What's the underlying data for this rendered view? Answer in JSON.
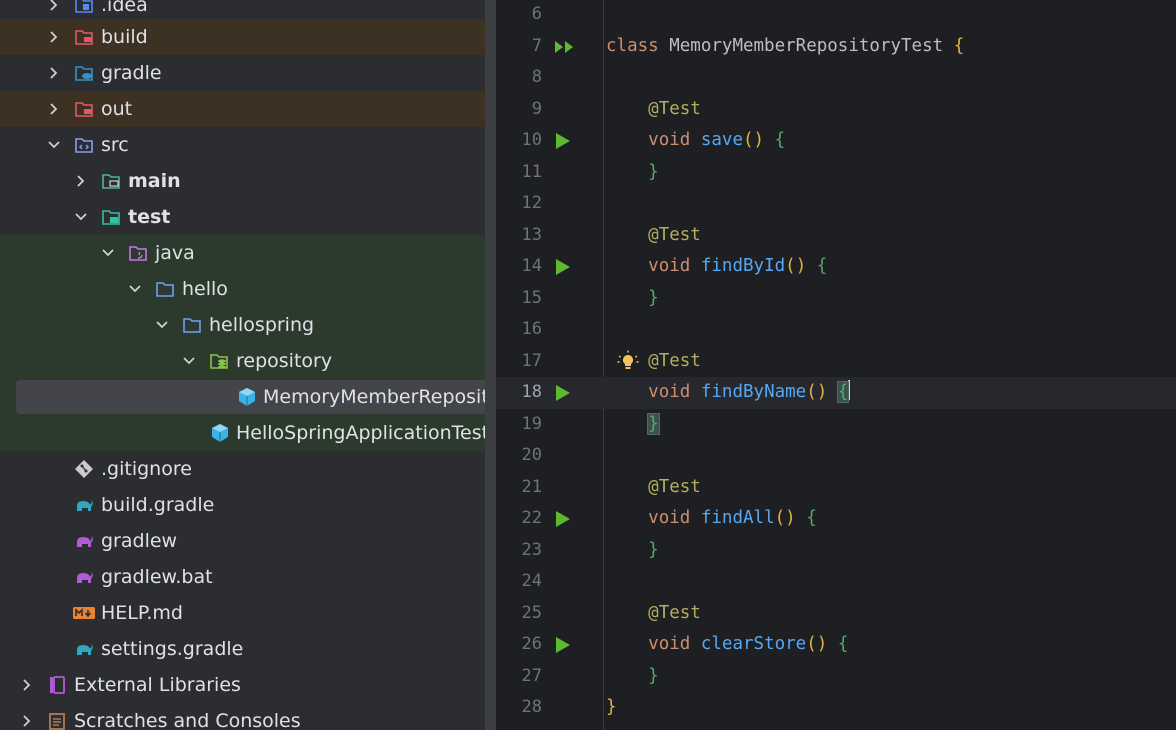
{
  "project_tree": {
    "items": [
      {
        "label": ".idea",
        "icon": "idea-folder-icon",
        "expanded": false
      },
      {
        "label": "build",
        "icon": "excluded-folder-icon",
        "expanded": false
      },
      {
        "label": "gradle",
        "icon": "gradle-folder-icon",
        "expanded": false
      },
      {
        "label": "out",
        "icon": "excluded-folder-icon",
        "expanded": false
      },
      {
        "label": "src",
        "icon": "source-folder-icon",
        "expanded": true
      },
      {
        "label": "main",
        "icon": "module-folder-icon",
        "expanded": false
      },
      {
        "label": "test",
        "icon": "test-module-folder-icon",
        "expanded": true
      },
      {
        "label": "java",
        "icon": "test-java-folder-icon",
        "expanded": true
      },
      {
        "label": "hello",
        "icon": "package-folder-icon",
        "expanded": true
      },
      {
        "label": "hellospring",
        "icon": "package-folder-icon",
        "expanded": true
      },
      {
        "label": "repository",
        "icon": "test-package-folder-icon",
        "expanded": true
      },
      {
        "label": "MemoryMemberRepositoryTest",
        "icon": "test-class-icon",
        "selected": true
      },
      {
        "label": "HelloSpringApplicationTests",
        "icon": "test-class-icon"
      },
      {
        "label": ".gitignore",
        "icon": "git-icon"
      },
      {
        "label": "build.gradle",
        "icon": "gradle-elephant-icon"
      },
      {
        "label": "gradlew",
        "icon": "gradle-script-icon"
      },
      {
        "label": "gradlew.bat",
        "icon": "gradle-script-icon"
      },
      {
        "label": "HELP.md",
        "icon": "markdown-icon"
      },
      {
        "label": "settings.gradle",
        "icon": "gradle-elephant-icon"
      },
      {
        "label": "External Libraries",
        "icon": "library-icon",
        "expanded": false
      },
      {
        "label": "Scratches and Consoles",
        "icon": "scratches-icon",
        "expanded": false
      }
    ]
  },
  "editor": {
    "current_line": "18",
    "lines": [
      {
        "num": "6"
      },
      {
        "num": "7",
        "class_kw": "class",
        "class_name": "MemoryMemberRepositoryTest",
        "open": "{"
      },
      {
        "num": "8"
      },
      {
        "num": "9",
        "annotation": "@Test"
      },
      {
        "num": "10",
        "type": "void",
        "method": "save",
        "parens": "()",
        "brace": "{"
      },
      {
        "num": "11",
        "brace": "}"
      },
      {
        "num": "12"
      },
      {
        "num": "13",
        "annotation": "@Test"
      },
      {
        "num": "14",
        "type": "void",
        "method": "findById",
        "parens": "()",
        "brace": "{"
      },
      {
        "num": "15",
        "brace": "}"
      },
      {
        "num": "16"
      },
      {
        "num": "17",
        "annotation": "@Test"
      },
      {
        "num": "18",
        "type": "void",
        "method": "findByName",
        "parens": "()",
        "brace": "{"
      },
      {
        "num": "19",
        "brace": "}"
      },
      {
        "num": "20"
      },
      {
        "num": "21",
        "annotation": "@Test"
      },
      {
        "num": "22",
        "type": "void",
        "method": "findAll",
        "parens": "()",
        "brace": "{"
      },
      {
        "num": "23",
        "brace": "}"
      },
      {
        "num": "24"
      },
      {
        "num": "25",
        "annotation": "@Test"
      },
      {
        "num": "26",
        "type": "void",
        "method": "clearStore",
        "parens": "()",
        "brace": "{"
      },
      {
        "num": "27",
        "brace": "}"
      },
      {
        "num": "28",
        "close": "}"
      }
    ]
  },
  "colors": {
    "keyword": "#cf8e6d",
    "annotation": "#b3ae60",
    "method": "#56a8f5",
    "run_gutter": "#5fb832",
    "excluded_bg": "#3d3123",
    "test_bg": "#2b3a2c"
  }
}
